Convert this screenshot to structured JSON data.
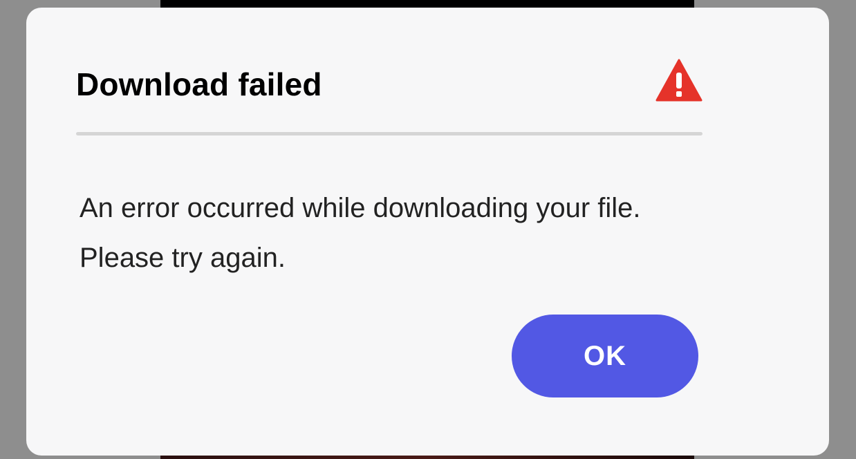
{
  "dialog": {
    "title": "Download failed",
    "icon": "warning-icon",
    "message": "An error occurred while downloading your file. Please try again.",
    "ok_label": "OK"
  },
  "colors": {
    "accent": "#5258e4",
    "warning": "#e5332a",
    "dialog_background": "#f7f7f8",
    "overlay": "#8e8e8e"
  }
}
